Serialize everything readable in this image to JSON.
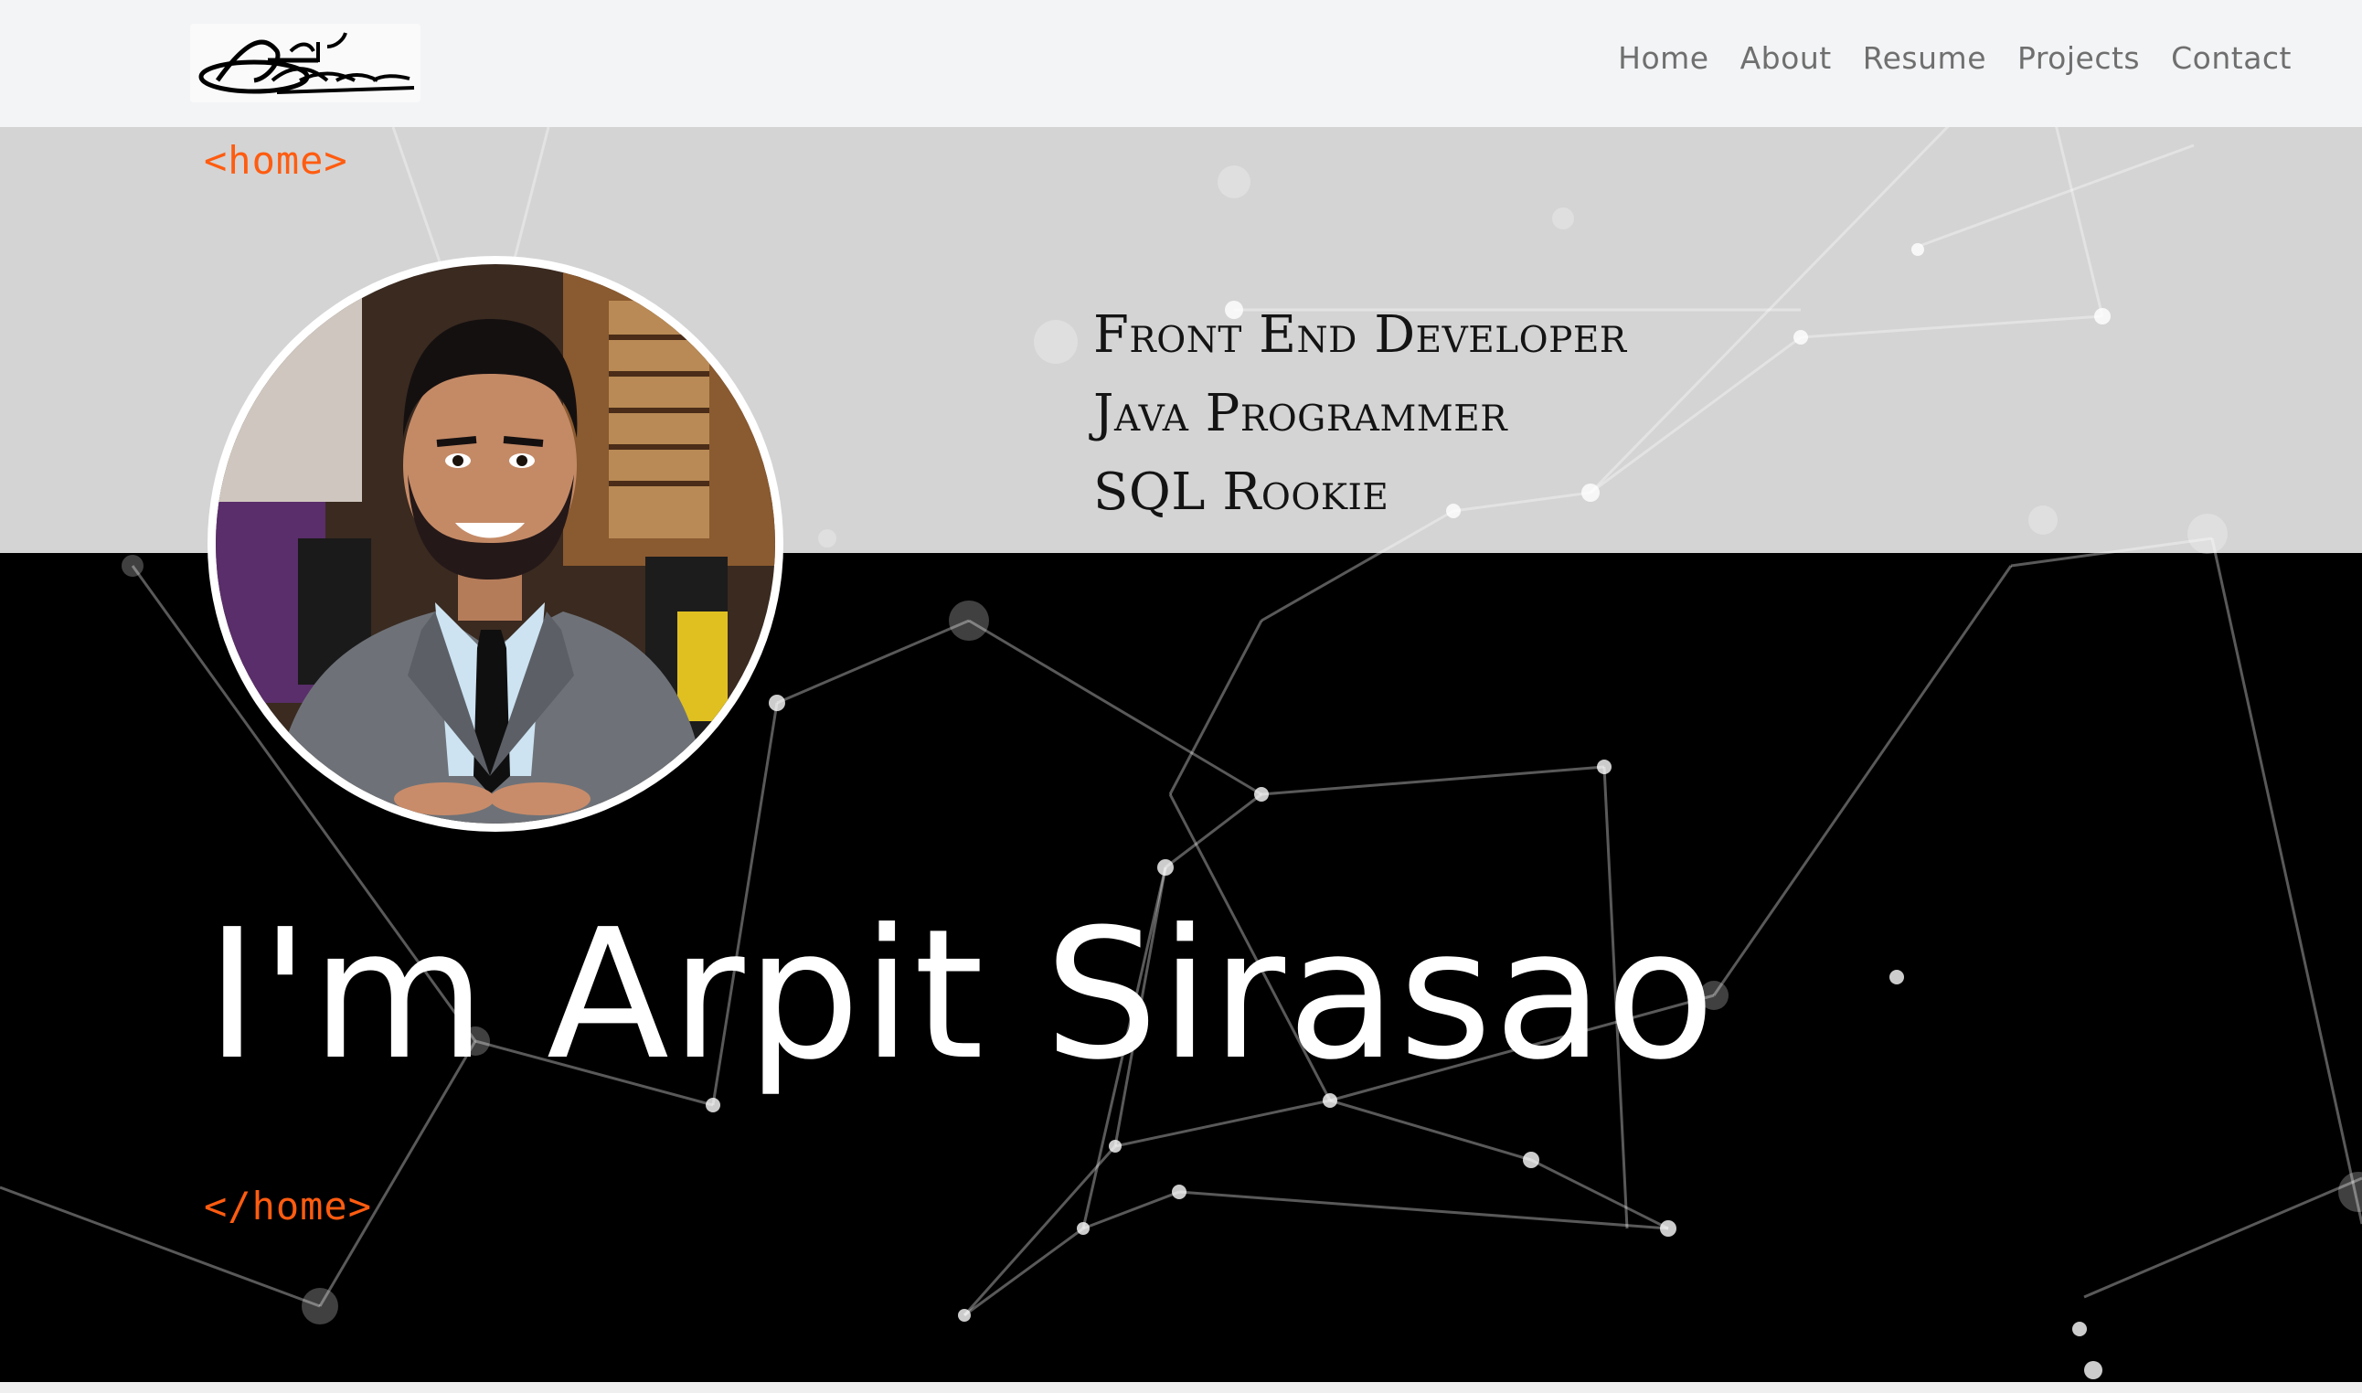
{
  "navbar": {
    "logo_alt": "Arpit Sirasao signature logo",
    "links": [
      "Home",
      "About",
      "Resume",
      "Projects",
      "Contact"
    ]
  },
  "hero": {
    "open_tag": "<home>",
    "close_tag": "</home>",
    "roles": [
      "Front End Developer",
      "Java Programmer",
      "SQL Rookie"
    ],
    "headline": "I'm Arpit Sirasao",
    "profile_photo": "profile-photo"
  },
  "colors": {
    "accent": "#ff5c10",
    "navbar_bg": "#f3f4f6",
    "hero_top_bg": "#d4d4d4",
    "hero_bottom_bg": "#000000",
    "headline": "#ffffff",
    "nav_text": "#6f6f6f"
  }
}
